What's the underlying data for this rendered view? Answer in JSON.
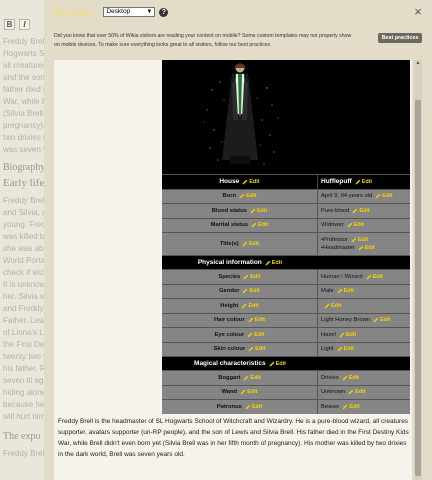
{
  "background": {
    "toolbar": [
      "B",
      "I"
    ],
    "text_lines_1": [
      "Freddy Brell i",
      "Hogwarts Scho",
      "all creatures s",
      "and the son of",
      "father died in",
      "War, while Br",
      "(Silvia Brell w",
      "pregnancy). H",
      "two drixies in",
      "was seven ye"
    ],
    "heading_1": "Biography",
    "heading_2": "Early life",
    "text_lines_2": [
      "Freddy Brell w",
      "and Silvia, and",
      "young. Freddy",
      "was killed by ",
      "she was abo",
      "World Portal",
      "check if wizar",
      "It is unknown",
      "her. Silvia wa",
      "and Freddy w",
      "Father. Lewis",
      "of Linna's Lob",
      "the First Des",
      "twenty two ye",
      "his father. Ra",
      "seven til age",
      "hiding alone",
      "because he w",
      "will hurt him."
    ],
    "heading_3": "The expo",
    "text_lines_3": [
      "Freddy Brell"
    ]
  },
  "modal": {
    "title": "Preview",
    "view_select": "Desktop",
    "help_icon": "?",
    "close_icon": "×",
    "notice": "Did you know that over 50% of Wikia visitors are reading your content on mobile? Some custom templates may not properly show on mobile devices. To make sure everything looks great to all visitors, follow our best practices.",
    "best_practices_button": "Best practices"
  },
  "edit_label": "Edit",
  "infobox": {
    "house_label": "House",
    "house_value": "Hufflepuff",
    "rows_1": [
      {
        "key": "Born",
        "value": "April 9, 94 years old"
      },
      {
        "key": "Blood status",
        "value": "Pure-blood"
      },
      {
        "key": "Marital status",
        "value": "Widower"
      }
    ],
    "titles_key": "Title(s)",
    "titles_values": [
      "•Professor",
      "•Headmaster"
    ],
    "section_physical": "Physical information",
    "rows_physical": [
      {
        "key": "Species",
        "value": "Human \\ Wizard"
      },
      {
        "key": "Gender",
        "value": "Male"
      },
      {
        "key": "Height",
        "value": ""
      },
      {
        "key": "Hair colour",
        "value": "Light Honey Brown"
      },
      {
        "key": "Eye colour",
        "value": "Hazel"
      },
      {
        "key": "Skin colour",
        "value": "Light"
      }
    ],
    "section_magical": "Magical characteristics",
    "rows_magical": [
      {
        "key": "Boggart",
        "value": "Drixies"
      },
      {
        "key": "Wand",
        "value": "Unknown"
      },
      {
        "key": "Patronus",
        "value": "Beaver"
      }
    ]
  },
  "article_text": "Freddy Brell is the headmaster of SL Hogwarts School of Witchcraft and Wizardry. He is a pure-blood wizard, all creatures supporter, avatars supporter (un-RP people), and the son of Lewis and Silvia Brell. His father died in the First Destiny Kids War, while Brell didn't even born yet (Silvia Brell was in her fifth month of pregnancy). His mother was killed by two drixies in the dark world, Brell was seven years old."
}
